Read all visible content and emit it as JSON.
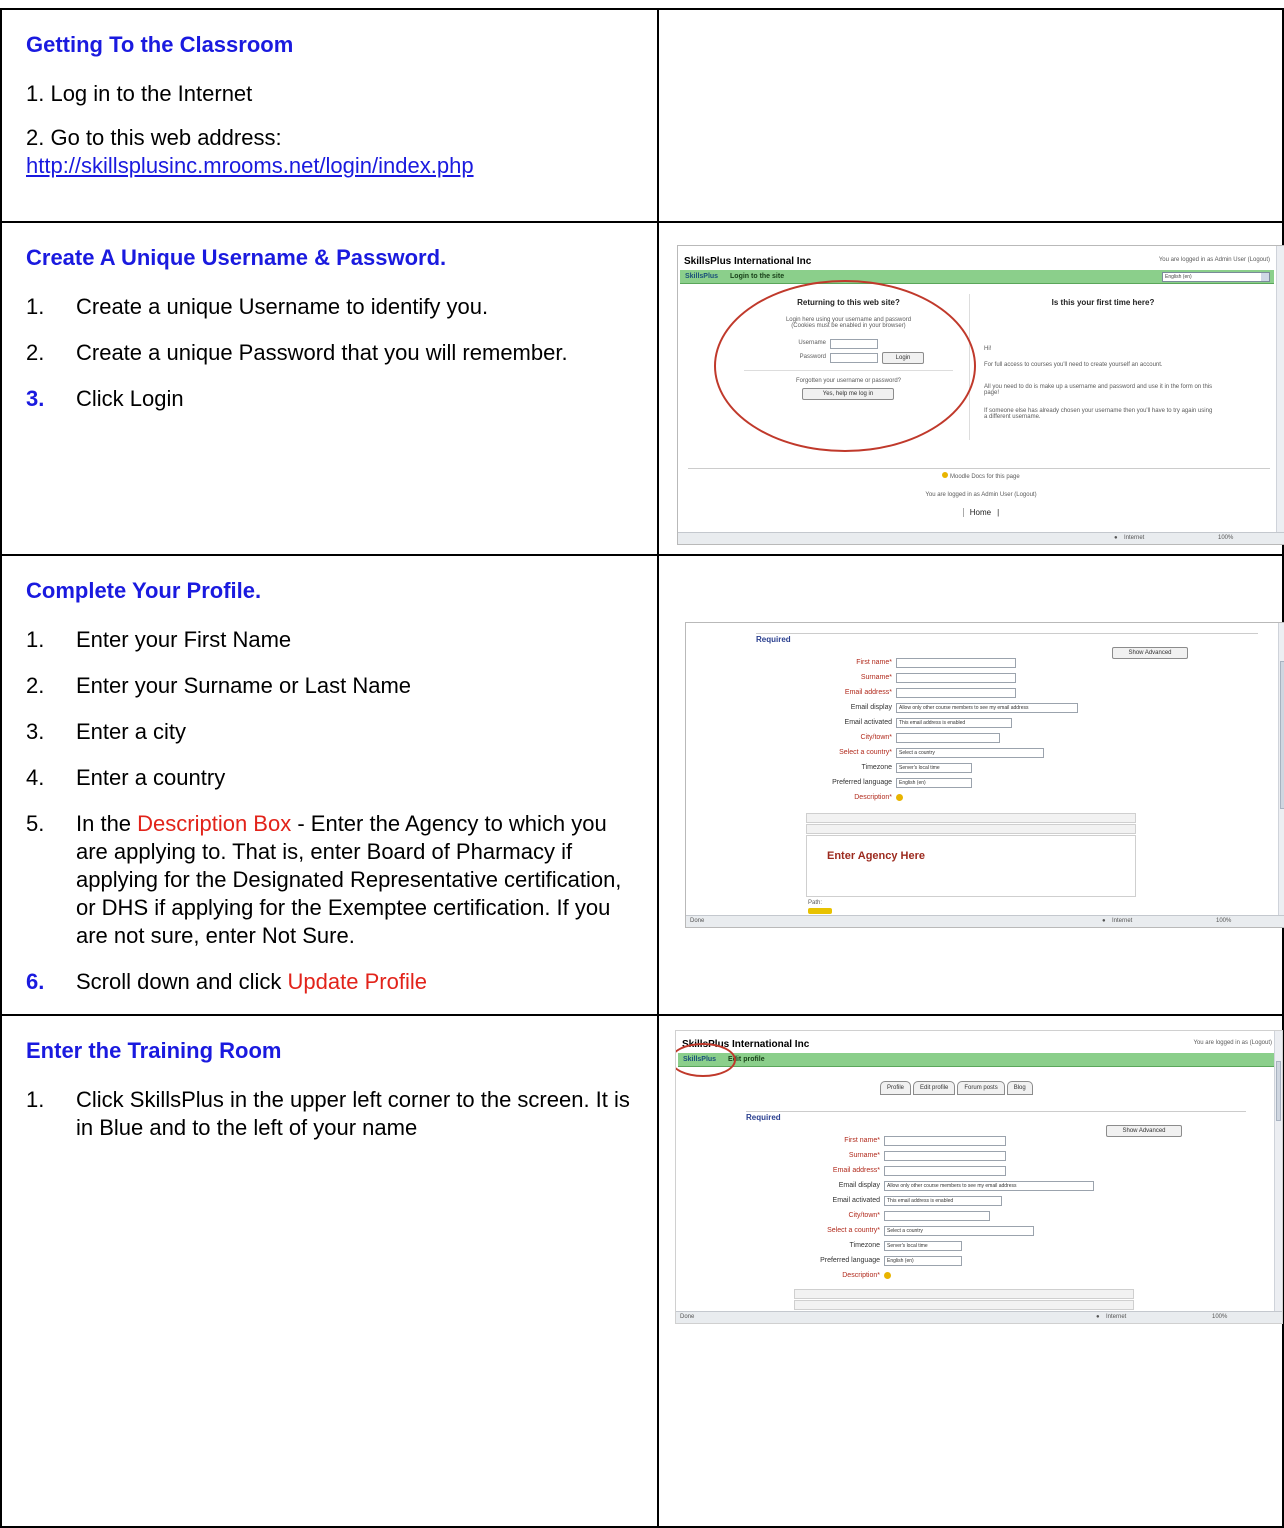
{
  "rows": [
    {
      "heading": "Getting To the Classroom",
      "para1": "1. Log in to the Internet",
      "para2": "2. Go to this web address:",
      "link": "http://skillsplusinc.mrooms.net/login/index.php"
    },
    {
      "heading": "Create A Unique Username & Password.",
      "steps": [
        {
          "num": "1.",
          "text": "Create a unique Username to identify you."
        },
        {
          "num": "2.",
          "text": "Create a unique Password that you will remember."
        },
        {
          "num": "3.",
          "text": "Click Login"
        }
      ]
    },
    {
      "heading": "Complete Your Profile.",
      "steps": [
        {
          "num": "1.",
          "text": "Enter your First Name"
        },
        {
          "num": "2.",
          "text": "Enter your Surname or Last Name"
        },
        {
          "num": "3.",
          "text": "Enter a city"
        },
        {
          "num": "4.",
          "text": "Enter a country"
        },
        {
          "num": "5.",
          "pre": "In the ",
          "highlight": "Description Box",
          "post": " - Enter the Agency to which you are applying to. That is, enter Board of Pharmacy if applying for the Designated Representative certification, or DHS if applying for the Exemptee certification. If you are not sure, enter Not Sure."
        },
        {
          "num": "6.",
          "pre": "Scroll down and click ",
          "highlight": "Update Profile"
        }
      ]
    },
    {
      "heading": "Enter the Training Room",
      "steps": [
        {
          "num": "1.",
          "text": "Click SkillsPlus in the upper left corner to the screen. It is in Blue and to the left of your name"
        }
      ]
    }
  ],
  "shot_login": {
    "site_title": "SkillsPlus International Inc",
    "logged_in": "You are logged in as Admin User (Logout)",
    "tab": "SkillsPlus",
    "crumb": "Login to the site",
    "language": "English (en)",
    "returning_title": "Returning to this web site?",
    "login_note1": "Login here using your username and password",
    "login_note2": "(Cookies must be enabled in your browser)",
    "username_label": "Username",
    "password_label": "Password",
    "login_button": "Login",
    "forgot_text": "Forgotten your username or password?",
    "help_button": "Yes, help me log in",
    "first_time_title": "Is this your first time here?",
    "hi": "Hi!",
    "info1": "For full access to courses you'll need to create yourself an account.",
    "info2": "All you need to do is make up a username and password and use it in the form on this page!",
    "info3": "If someone else has already chosen your username then you'll have to try again using a different username.",
    "docs_link": "Moodle Docs for this page",
    "footer_logged": "You are logged in as Admin User (Logout)",
    "home": "Home",
    "status_zone": "Internet",
    "status_zoom": "100%"
  },
  "shot_profile": {
    "section": "Required",
    "show_advanced": "Show Advanced",
    "first_name": "First name*",
    "surname": "Surname*",
    "email": "Email address*",
    "email_display": "Email display",
    "email_display_value": "Allow only other course members to see my email address",
    "email_activated": "Email activated",
    "email_activated_value": "This email address is enabled",
    "city": "City/town*",
    "country": "Select a country*",
    "country_value": "Select a country",
    "timezone": "Timezone",
    "timezone_value": "Server's local time",
    "pref_lang": "Preferred language",
    "pref_lang_value": "English (en)",
    "description": "Description*",
    "editor_text": "Enter Agency Here",
    "path": "Path:",
    "status_done": "Done",
    "status_zone": "Internet",
    "status_zoom": "100%"
  },
  "shot_edit": {
    "site_title": "SkillsPlus International Inc",
    "logged_in": "You are logged in as (Logout)",
    "tab": "SkillsPlus",
    "crumb": "Edit profile",
    "tabs": [
      "Profile",
      "Edit profile",
      "Forum posts",
      "Blog"
    ],
    "section": "Required",
    "show_advanced": "Show Advanced",
    "first_name": "First name*",
    "surname": "Surname*",
    "email": "Email address*",
    "email_display": "Email display",
    "email_display_value": "Allow only other course members to see my email address",
    "email_activated": "Email activated",
    "email_activated_value": "This email address is enabled",
    "city": "City/town*",
    "country": "Select a country*",
    "country_value": "Select a country",
    "timezone": "Timezone",
    "timezone_value": "Server's local time",
    "pref_lang": "Preferred language",
    "pref_lang_value": "English (en)",
    "description": "Description*",
    "status_done": "Done",
    "status_zone": "Internet",
    "status_zoom": "100%"
  }
}
